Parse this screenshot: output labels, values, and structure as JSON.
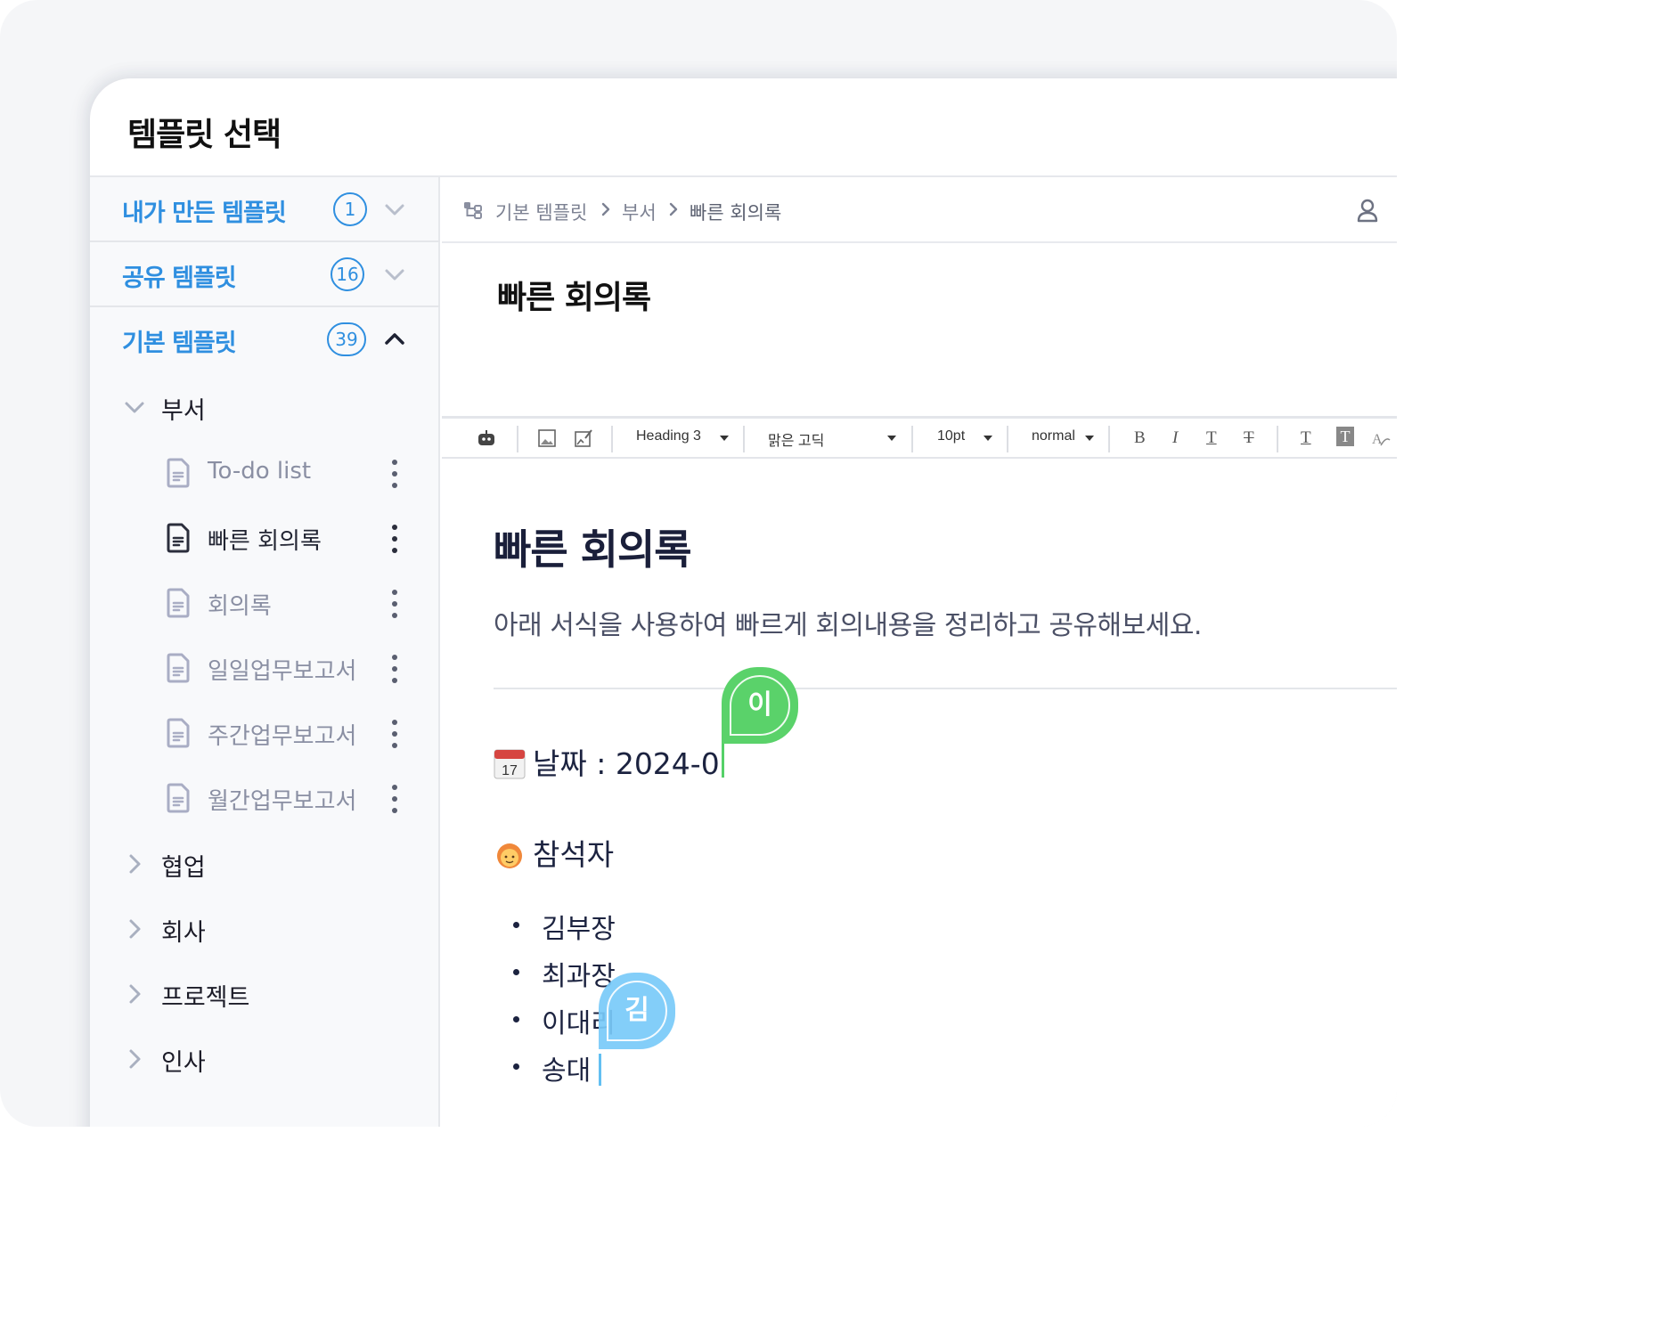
{
  "window": {
    "title": "템플릿 선택"
  },
  "sidebar": {
    "groups": [
      {
        "label": "내가 만든 템플릿",
        "count": "1",
        "expanded": false
      },
      {
        "label": "공유 템플릿",
        "count": "16",
        "expanded": false
      },
      {
        "label": "기본 템플릿",
        "count": "39",
        "expanded": true
      }
    ],
    "folders": [
      {
        "label": "부서",
        "expanded": true
      },
      {
        "label": "협업",
        "expanded": false
      },
      {
        "label": "회사",
        "expanded": false
      },
      {
        "label": "프로젝트",
        "expanded": false
      },
      {
        "label": "인사",
        "expanded": false
      }
    ],
    "docs": [
      {
        "label": "To-do list",
        "active": false
      },
      {
        "label": "빠른 회의록",
        "active": true
      },
      {
        "label": "회의록",
        "active": false
      },
      {
        "label": "일일업무보고서",
        "active": false
      },
      {
        "label": "주간업무보고서",
        "active": false
      },
      {
        "label": "월간업무보고서",
        "active": false
      }
    ],
    "accent_color": "#2f8fe0"
  },
  "breadcrumb": {
    "items": [
      "기본 템플릿",
      "부서",
      "빠른 회의록"
    ]
  },
  "doc_title": "빠른 회의록",
  "toolbar": {
    "heading": "Heading 3",
    "font": "맑은 고딕",
    "size": "10pt",
    "spacing": "normal",
    "bold_label": "B",
    "italic_label": "I",
    "underline_label": "T",
    "strike_label": "T",
    "text_label": "T",
    "bg_label": "T",
    "icons": [
      "bot-icon",
      "image-icon",
      "edit-image-icon",
      "bold-icon",
      "italic-icon",
      "underline-icon",
      "strike-icon",
      "font-color-icon",
      "highlight-icon",
      "clear-format-icon"
    ]
  },
  "editor": {
    "heading": "빠른 회의록",
    "description": "아래 서식을 사용하여 빠르게 회의내용을 정리하고 공유해보세요.",
    "date_line": "날짜 : 2024-0",
    "calendar_emoji": "17",
    "attendees_heading": "참석자",
    "attendees": [
      "김부장",
      "최과장",
      "이대리",
      "송대"
    ]
  },
  "collaborators": [
    {
      "initial": "이",
      "color": "#5ad26a"
    },
    {
      "initial": "김",
      "color": "#78caf8"
    }
  ]
}
